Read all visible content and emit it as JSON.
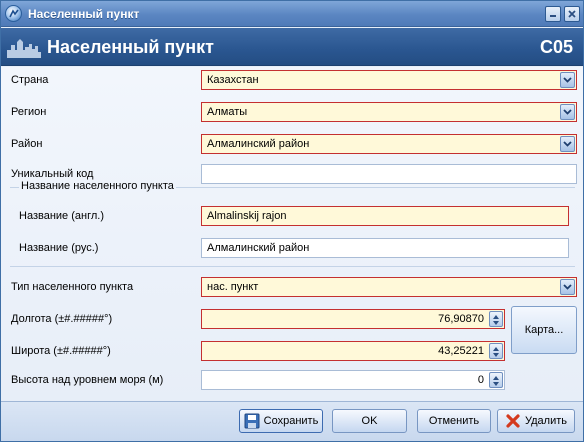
{
  "window": {
    "title": "Населенный пункт"
  },
  "header": {
    "title": "Населенный пункт",
    "code": "C05"
  },
  "form": {
    "country": {
      "label": "Страна",
      "value": "Казахстан"
    },
    "region": {
      "label": "Регион",
      "value": "Алматы"
    },
    "district": {
      "label": "Район",
      "value": "Алмалинский район"
    },
    "unique_code": {
      "label": "Уникальный код",
      "value": ""
    },
    "name_group": {
      "title": "Название населенного пункта",
      "name_en": {
        "label": "Название (англ.)",
        "value": "Almalinskij rajon"
      },
      "name_ru": {
        "label": "Название (рус.)",
        "value": "Алмалинский район"
      }
    },
    "locality_type": {
      "label": "Тип населенного пункта",
      "value": "нас. пункт"
    },
    "longitude": {
      "label": "Долгота (±#.#####°)",
      "value": "76,90870"
    },
    "latitude": {
      "label": "Широта (±#.#####°)",
      "value": "43,25221"
    },
    "altitude": {
      "label": "Высота над уровнем моря (м)",
      "value": "0"
    },
    "map_button": "Карта..."
  },
  "buttons": {
    "save": "Сохранить",
    "ok": "OK",
    "cancel": "Отменить",
    "delete": "Удалить"
  },
  "colors": {
    "required_bg": "#fff9d9",
    "required_border": "#c43030",
    "header_bg": "#2a5690"
  }
}
